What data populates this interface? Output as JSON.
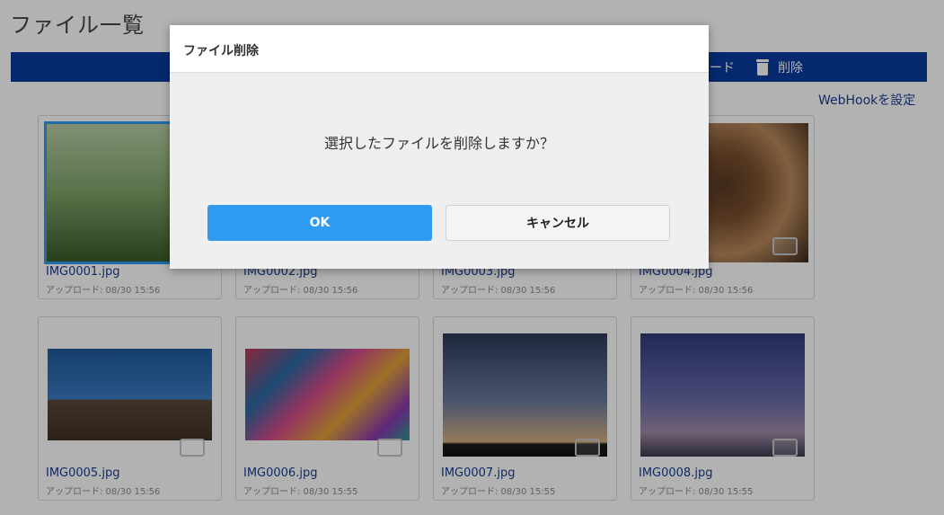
{
  "page": {
    "title": "ファイル一覧"
  },
  "toolbar": {
    "download_label": "ード",
    "delete_label": "削除"
  },
  "webhook": {
    "label": "WebHookを設定"
  },
  "files": [
    {
      "name": "IMG0001.jpg",
      "uploaded": "アップロード: 08/30 15:56"
    },
    {
      "name": "IMG0002.jpg",
      "uploaded": "アップロード: 08/30 15:56"
    },
    {
      "name": "IMG0003.jpg",
      "uploaded": "アップロード: 08/30 15:56"
    },
    {
      "name": "IMG0004.jpg",
      "uploaded": "アップロード: 08/30 15:56"
    },
    {
      "name": "IMG0005.jpg",
      "uploaded": "アップロード: 08/30 15:56"
    },
    {
      "name": "IMG0006.jpg",
      "uploaded": "アップロード: 08/30 15:55"
    },
    {
      "name": "IMG0007.jpg",
      "uploaded": "アップロード: 08/30 15:55"
    },
    {
      "name": "IMG0008.jpg",
      "uploaded": "アップロード: 08/30 15:55"
    }
  ],
  "dialog": {
    "title": "ファイル削除",
    "message": "選択したファイルを削除しますか？",
    "ok_label": "OK",
    "cancel_label": "キャンセル"
  },
  "colors": {
    "toolbar_bg": "#0a3c9c",
    "ok_button": "#2f9bf0",
    "selection": "#2d9bf0"
  }
}
